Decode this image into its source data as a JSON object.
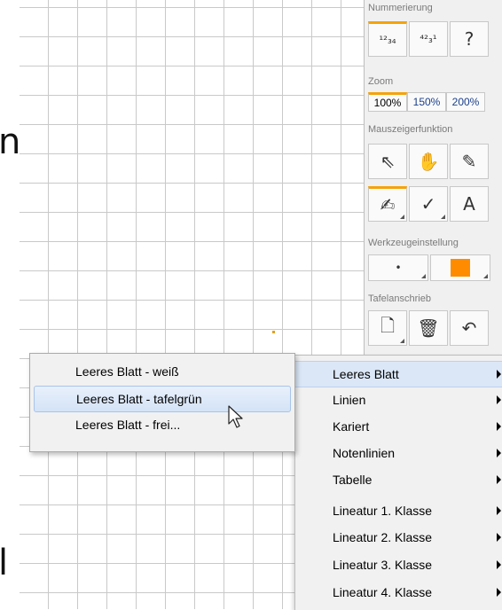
{
  "canvas": {
    "left_letters": [
      "n",
      "l"
    ]
  },
  "panel": {
    "sections": {
      "numbering": {
        "label": "Nummerierung",
        "buttons": [
          {
            "name": "numbering-123-button",
            "glyph": "¹²₃₄"
          },
          {
            "name": "numbering-shuffle-button",
            "glyph": "⁴²₃¹"
          },
          {
            "name": "numbering-help-button",
            "glyph": "?"
          }
        ]
      },
      "zoom": {
        "label": "Zoom",
        "options": [
          "100%",
          "150%",
          "200%"
        ],
        "selected": "100%"
      },
      "pointer": {
        "label": "Mauszeigerfunktion",
        "tools": [
          {
            "glyph": "⇖"
          },
          {
            "glyph": "✋"
          },
          {
            "glyph": "✎"
          },
          {
            "glyph": "✍"
          },
          {
            "glyph": "✓"
          },
          {
            "glyph": "A"
          }
        ]
      },
      "tool_settings": {
        "label": "Werkzeugeinstellung",
        "color": "#ff8c00",
        "dot": "•"
      },
      "board": {
        "label": "Tafelanschrieb",
        "buttons": [
          {
            "glyph": "🗋"
          },
          {
            "glyph": "🗑"
          },
          {
            "glyph": "↶"
          }
        ]
      }
    }
  },
  "context_menu": {
    "items": [
      "Leeres Blatt",
      "Linien",
      "Kariert",
      "Notenlinien",
      "Tabelle",
      "Lineatur 1. Klasse",
      "Lineatur 2. Klasse",
      "Lineatur 3. Klasse",
      "Lineatur 4. Klasse"
    ],
    "highlighted": "Leeres Blatt"
  },
  "submenu": {
    "items": [
      "Leeres Blatt - weiß",
      "Leeres Blatt - tafelgrün",
      "Leeres Blatt - frei..."
    ],
    "highlighted": "Leeres Blatt - tafelgrün"
  }
}
